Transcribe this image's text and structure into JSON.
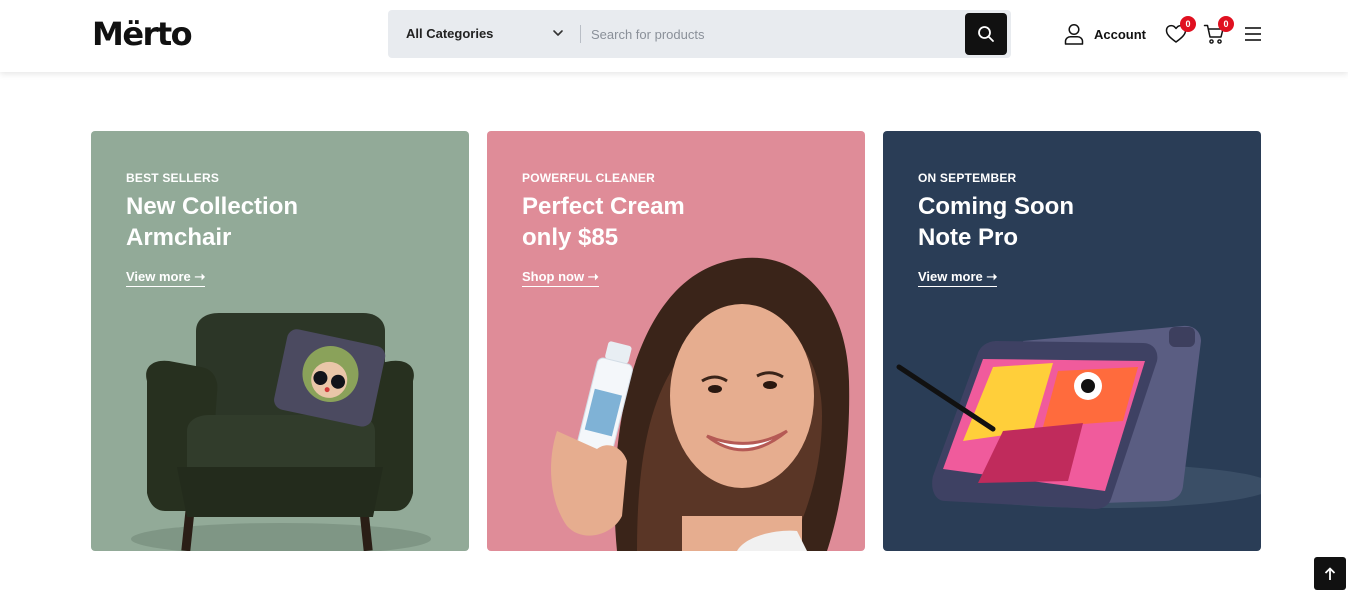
{
  "brand": {
    "name": "Mërto"
  },
  "search": {
    "category_selected": "All Categories",
    "placeholder": "Search for products",
    "value": ""
  },
  "header": {
    "account_label": "Account",
    "wishlist_count": "0",
    "cart_count": "0"
  },
  "banners": [
    {
      "eyebrow": "BEST SELLERS",
      "line1": "New Collection",
      "line2": "Armchair",
      "cta": "View more ➝",
      "bg": "#92aa98"
    },
    {
      "eyebrow": "POWERFUL CLEANER",
      "line1": "Perfect Cream",
      "line2": "only $85",
      "cta": "Shop now ➝",
      "bg": "#df8c98"
    },
    {
      "eyebrow": "ON SEPTEMBER",
      "line1": "Coming Soon",
      "line2": "Note Pro",
      "cta": "View more ➝",
      "bg": "#2a3d56"
    }
  ],
  "colors": {
    "accent": "#111111",
    "badge": "#e01020",
    "search_bg": "#e8ebef"
  }
}
